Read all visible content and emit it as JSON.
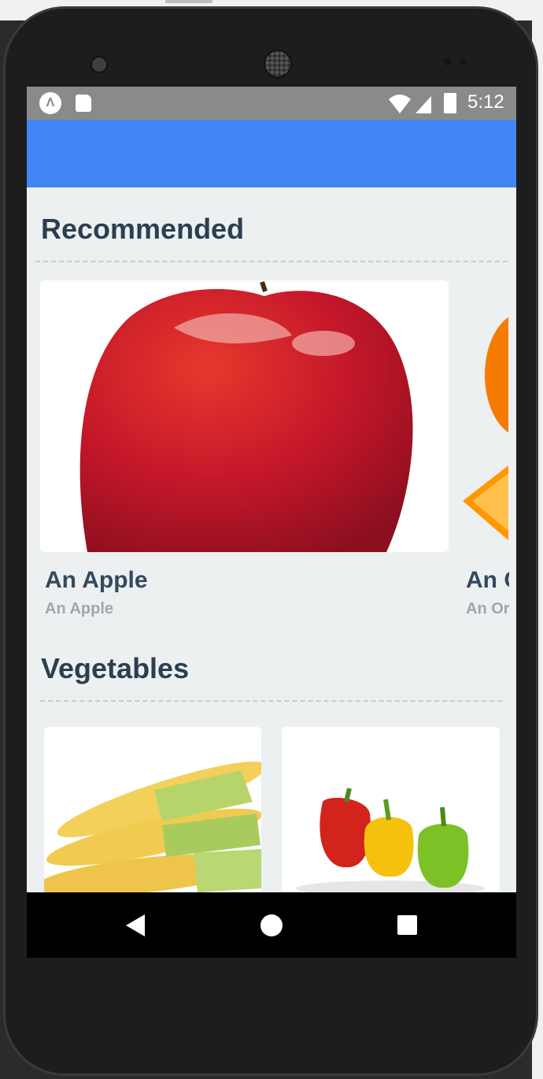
{
  "status_bar": {
    "time": "5:12",
    "icons": [
      "expo-icon",
      "sd-card-icon",
      "wifi-icon",
      "signal-icon",
      "battery-icon"
    ]
  },
  "app_bar": {
    "color": "#4285f4"
  },
  "sections": {
    "recommended": {
      "title": "Recommended",
      "items": [
        {
          "title": "An Apple",
          "subtitle": "An Apple",
          "image": "apple-image"
        },
        {
          "title": "An Orange",
          "subtitle": "An Orange",
          "image": "orange-image"
        }
      ]
    },
    "vegetables": {
      "title": "Vegetables",
      "items": [
        {
          "image": "baby-corn-image"
        },
        {
          "image": "bell-peppers-image"
        }
      ]
    }
  },
  "nav_bar": {
    "buttons": [
      "back-icon",
      "home-icon",
      "recents-icon"
    ]
  },
  "colors": {
    "title": "#2c3e50",
    "subtitle": "#a0a6ab",
    "background": "#ecf0f1"
  }
}
